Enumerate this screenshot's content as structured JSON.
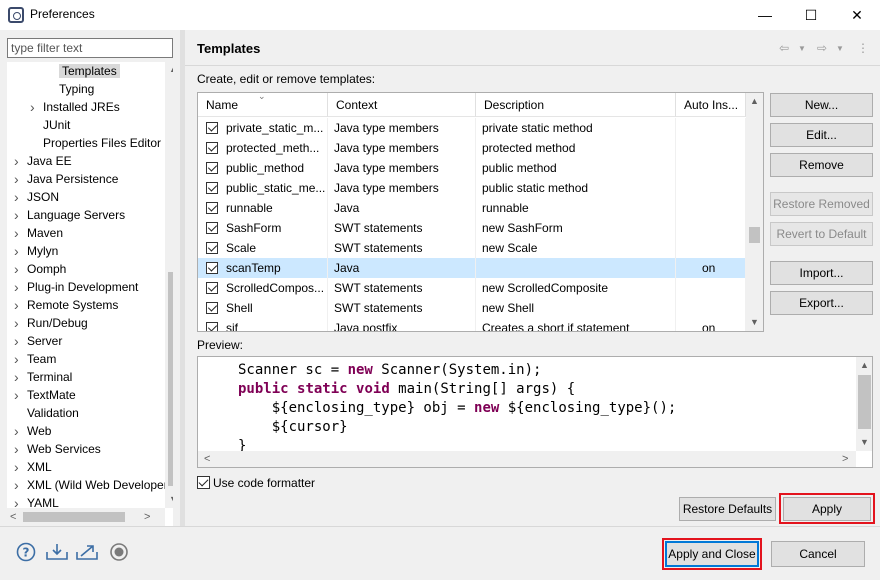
{
  "window": {
    "title": "Preferences",
    "minimize": "—",
    "maximize": "☐",
    "close": "✕"
  },
  "filter": {
    "placeholder": "type filter text"
  },
  "tree": {
    "items": [
      {
        "label": "Templates",
        "indent": 3,
        "selected": true,
        "arrow": ""
      },
      {
        "label": "Typing",
        "indent": 3,
        "arrow": ""
      },
      {
        "label": "Installed JREs",
        "indent": 2,
        "arrow": ">"
      },
      {
        "label": "JUnit",
        "indent": 2,
        "arrow": ""
      },
      {
        "label": "Properties Files Editor",
        "indent": 2,
        "arrow": ""
      },
      {
        "label": "Java EE",
        "indent": 1,
        "arrow": ">"
      },
      {
        "label": "Java Persistence",
        "indent": 1,
        "arrow": ">"
      },
      {
        "label": "JSON",
        "indent": 1,
        "arrow": ">"
      },
      {
        "label": "Language Servers",
        "indent": 1,
        "arrow": ">"
      },
      {
        "label": "Maven",
        "indent": 1,
        "arrow": ">"
      },
      {
        "label": "Mylyn",
        "indent": 1,
        "arrow": ">"
      },
      {
        "label": "Oomph",
        "indent": 1,
        "arrow": ">"
      },
      {
        "label": "Plug-in Development",
        "indent": 1,
        "arrow": ">"
      },
      {
        "label": "Remote Systems",
        "indent": 1,
        "arrow": ">"
      },
      {
        "label": "Run/Debug",
        "indent": 1,
        "arrow": ">"
      },
      {
        "label": "Server",
        "indent": 1,
        "arrow": ">"
      },
      {
        "label": "Team",
        "indent": 1,
        "arrow": ">"
      },
      {
        "label": "Terminal",
        "indent": 1,
        "arrow": ">"
      },
      {
        "label": "TextMate",
        "indent": 1,
        "arrow": ">"
      },
      {
        "label": "Validation",
        "indent": 1,
        "arrow": ""
      },
      {
        "label": "Web",
        "indent": 1,
        "arrow": ">"
      },
      {
        "label": "Web Services",
        "indent": 1,
        "arrow": ">"
      },
      {
        "label": "XML",
        "indent": 1,
        "arrow": ">"
      },
      {
        "label": "XML (Wild Web Developer)",
        "indent": 1,
        "arrow": ">"
      },
      {
        "label": "YAML",
        "indent": 1,
        "arrow": ">"
      }
    ]
  },
  "page": {
    "title": "Templates",
    "description": "Create, edit or remove templates:",
    "back_icon": "⇦",
    "forward_icon": "⇨",
    "menu_icon": "⋮"
  },
  "table": {
    "headers": [
      "Name",
      "Context",
      "Description",
      "Auto Ins..."
    ],
    "rows": [
      {
        "name": "private_static_m...",
        "context": "Java type members",
        "description": "private static method",
        "auto": ""
      },
      {
        "name": "protected_meth...",
        "context": "Java type members",
        "description": "protected method",
        "auto": ""
      },
      {
        "name": "public_method",
        "context": "Java type members",
        "description": "public method",
        "auto": ""
      },
      {
        "name": "public_static_me...",
        "context": "Java type members",
        "description": "public static method",
        "auto": ""
      },
      {
        "name": "runnable",
        "context": "Java",
        "description": "runnable",
        "auto": ""
      },
      {
        "name": "SashForm",
        "context": "SWT statements",
        "description": "new SashForm",
        "auto": ""
      },
      {
        "name": "Scale",
        "context": "SWT statements",
        "description": "new Scale",
        "auto": ""
      },
      {
        "name": "scanTemp",
        "context": "Java",
        "description": "",
        "auto": "on",
        "selected": true
      },
      {
        "name": "ScrolledCompos...",
        "context": "SWT statements",
        "description": "new ScrolledComposite",
        "auto": ""
      },
      {
        "name": "Shell",
        "context": "SWT statements",
        "description": "new Shell",
        "auto": ""
      },
      {
        "name": "sif",
        "context": "Java postfix",
        "description": "Creates a short if statement",
        "auto": "on"
      }
    ]
  },
  "side_buttons": {
    "new": "New...",
    "edit": "Edit...",
    "remove": "Remove",
    "restore_removed": "Restore Removed",
    "revert_default": "Revert to Default",
    "import": "Import...",
    "export": "Export..."
  },
  "preview": {
    "label": "Preview:",
    "lines": [
      [
        {
          "t": "Scanner sc = "
        },
        {
          "t": "new",
          "kw": true
        },
        {
          "t": " Scanner(System.in);"
        }
      ],
      [
        {
          "t": "public",
          "kw": true
        },
        {
          "t": " "
        },
        {
          "t": "static",
          "kw": true
        },
        {
          "t": " "
        },
        {
          "t": "void",
          "kw": true
        },
        {
          "t": " main(String[] args) {"
        }
      ],
      [
        {
          "t": "    ${enclosing_type} obj = "
        },
        {
          "t": "new",
          "kw": true
        },
        {
          "t": " ${enclosing_type}();"
        }
      ],
      [
        {
          "t": "    ${cursor}"
        }
      ],
      [
        {
          "t": "}"
        }
      ]
    ]
  },
  "use_formatter": {
    "label": "Use code formatter",
    "checked": true
  },
  "buttons": {
    "restore_defaults": "Restore Defaults",
    "apply": "Apply",
    "apply_close": "Apply and Close",
    "cancel": "Cancel"
  },
  "colors": {
    "highlight": "#e3131d",
    "selection": "#cce8ff",
    "keyword": "#7f0055"
  }
}
